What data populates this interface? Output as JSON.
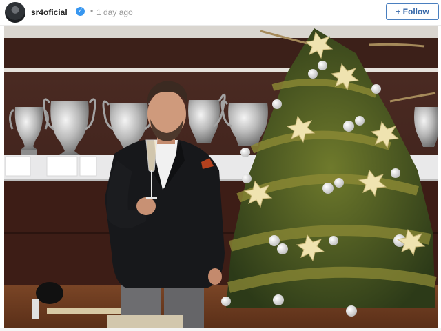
{
  "header": {
    "username": "sr4oficial",
    "verified_badge_glyph": "✓",
    "separator": "•",
    "timestamp": "1 day ago",
    "follow_label": "+ Follow"
  },
  "icons": {
    "avatar": "profile-avatar",
    "verified": "verified-badge-icon"
  },
  "colors": {
    "verified_blue": "#3897f0",
    "follow_text": "#3567a8",
    "follow_border": "#4a7fbf",
    "username": "#262626",
    "meta_gray": "#999999"
  },
  "photo": {
    "subject": "man in dark blazer raising champagne glass beside decorated Christmas tree with trophies"
  }
}
